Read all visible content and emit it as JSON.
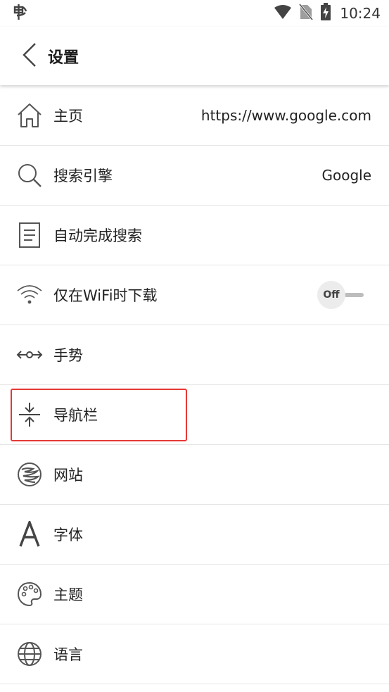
{
  "status_bar": {
    "time": "10:24",
    "left_icon": "app-notification-icon",
    "icons": [
      "wifi-icon",
      "no-sim-icon",
      "battery-charging-icon"
    ]
  },
  "toolbar": {
    "title": "设置",
    "back_icon": "back-arrow-icon"
  },
  "settings": {
    "items": [
      {
        "label": "主页",
        "value": "https://www.google.com",
        "icon": "home-icon"
      },
      {
        "label": "搜索引擎",
        "value": "Google",
        "icon": "search-icon"
      },
      {
        "label": "自动完成搜索",
        "icon": "document-list-icon"
      },
      {
        "label": "仅在WiFi时下载",
        "icon": "wifi-icon",
        "toggle": "Off"
      },
      {
        "label": "手势",
        "icon": "gesture-arrows-icon"
      },
      {
        "label": "导航栏",
        "icon": "collapse-vertical-icon"
      },
      {
        "label": "网站",
        "icon": "website-icon"
      },
      {
        "label": "字体",
        "icon": "font-icon"
      },
      {
        "label": "主题",
        "icon": "palette-icon"
      },
      {
        "label": "语言",
        "icon": "globe-icon"
      }
    ]
  },
  "highlight_color": "#e53935"
}
